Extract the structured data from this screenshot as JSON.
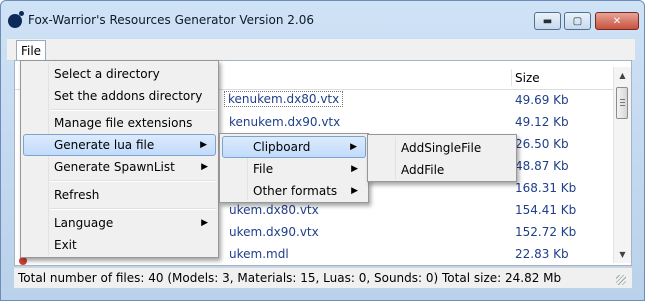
{
  "window": {
    "title": "Fox-Warrior's Resources Generator Version 2.06",
    "icon": "fox-app-icon",
    "controls": {
      "minimize": "▬",
      "maximize": "▢",
      "close": "✕"
    }
  },
  "menubar": {
    "file_label": "File"
  },
  "list": {
    "size_header": "Size",
    "rows": [
      {
        "name": "kenukem.dx80.vtx",
        "size": "49.69 Kb"
      },
      {
        "name": "kenukem.dx90.vtx",
        "size": "49.12 Kb"
      },
      {
        "name": "",
        "size": "26.50 Kb"
      },
      {
        "name": "",
        "size": "48.87 Kb"
      },
      {
        "name": "",
        "size": "168.31 Kb"
      },
      {
        "name": "ukem.dx80.vtx",
        "size": "154.41 Kb"
      },
      {
        "name": "ukem.dx90.vtx",
        "size": "152.72 Kb"
      },
      {
        "name": "ukem.mdl",
        "size": "22.83 Kb"
      }
    ]
  },
  "status": {
    "text": "Total number of files: 40 (Models: 3, Materials: 15, Luas: 0, Sounds: 0) Total size: 24.82 Mb"
  },
  "file_menu": {
    "items": [
      {
        "label": "Select a directory"
      },
      {
        "label": "Set the addons directory"
      },
      {
        "label": "Manage file extensions"
      },
      {
        "label": "Generate lua file",
        "arrow": "▶"
      },
      {
        "label": "Generate SpawnList",
        "arrow": "▶"
      },
      {
        "label": "Refresh"
      },
      {
        "label": "Language",
        "arrow": "▶"
      },
      {
        "label": "Exit"
      }
    ]
  },
  "lua_submenu": {
    "items": [
      {
        "label": "Clipboard",
        "arrow": "▶"
      },
      {
        "label": "File",
        "arrow": "▶"
      },
      {
        "label": "Other formats",
        "arrow": "▶"
      }
    ]
  },
  "clipboard_submenu": {
    "items": [
      {
        "label": "AddSingleFile"
      },
      {
        "label": "AddFile"
      }
    ]
  }
}
